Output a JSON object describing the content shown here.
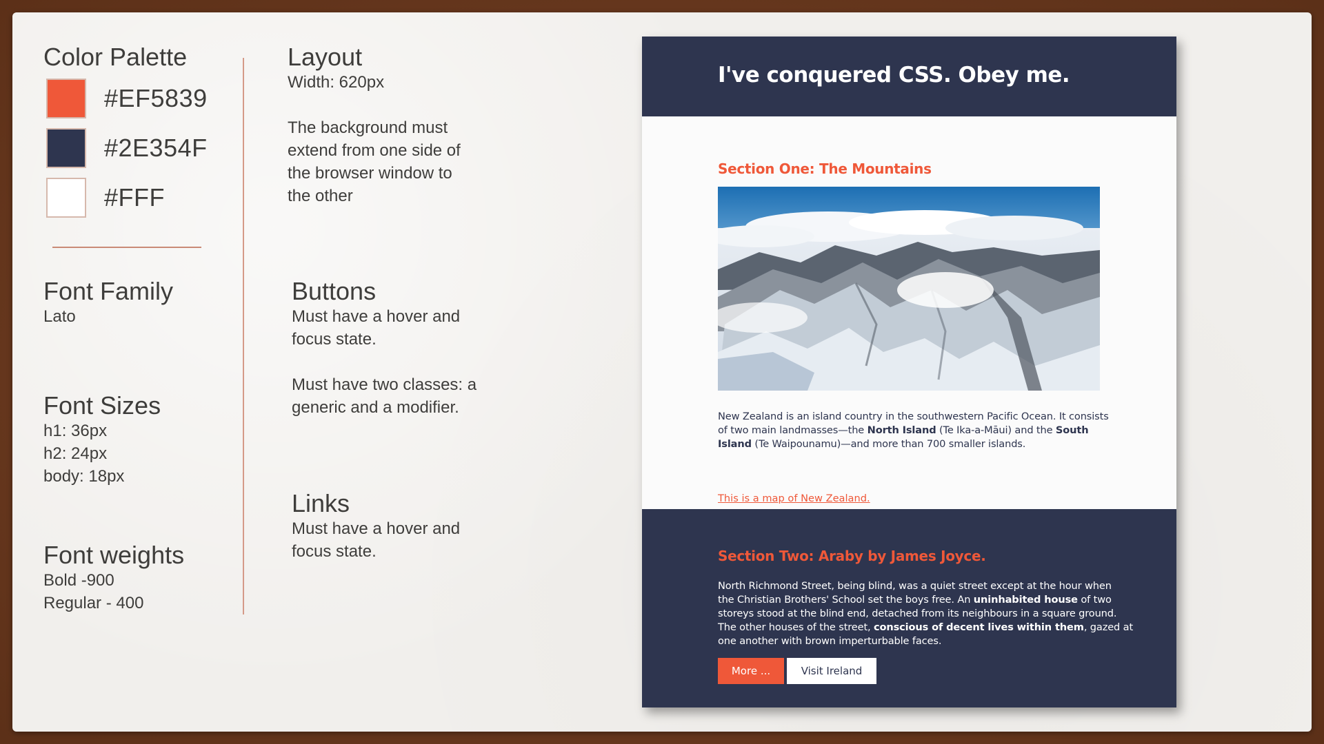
{
  "palette": {
    "title": "Color Palette",
    "colors": [
      {
        "hex": "#EF5839",
        "label": "#EF5839"
      },
      {
        "hex": "#2E354F",
        "label": "#2E354F"
      },
      {
        "hex": "#FFFFFF",
        "label": "#FFF"
      }
    ]
  },
  "font_family": {
    "title": "Font Family",
    "value": "Lato"
  },
  "font_sizes": {
    "title": "Font Sizes",
    "lines": [
      "h1: 36px",
      "h2: 24px",
      "body: 18px"
    ]
  },
  "font_weights": {
    "title": "Font weights",
    "lines": [
      "Bold -900",
      "Regular - 400"
    ]
  },
  "layout": {
    "title": "Layout",
    "width": "Width: 620px",
    "lines": [
      "The background must",
      "extend from one side of",
      "the browser window to",
      "the other"
    ]
  },
  "buttons": {
    "title": "Buttons",
    "lines1": [
      "Must have a hover and",
      "focus state."
    ],
    "lines2": [
      "Must have two classes: a",
      "generic and a modifier."
    ]
  },
  "links": {
    "title": "Links",
    "lines": [
      "Must have a hover and",
      "focus state."
    ]
  },
  "mock": {
    "h1": "I've conquered CSS. Obey me.",
    "section1": {
      "h2": "Section One: The Mountains",
      "image_alt": "snowy-mountain-photo",
      "p_line1": "New Zealand is an island country in the southwestern Pacific Ocean. It consists",
      "p_line2_a": "of two main landmasses—the ",
      "p_line2_b": "North Island",
      "p_line2_c": " (Te Ika-a-Māui) and the ",
      "p_line2_d": "South",
      "p_line3_a": "Island",
      "p_line3_b": " (Te Waipounamu)—and more than 700 smaller islands.",
      "link": "This is a map of New Zealand."
    },
    "section2": {
      "h2": "Section Two: Araby by James Joyce.",
      "l1": "North Richmond Street, being blind, was a quiet street except at the hour when",
      "l2a": "the Christian Brothers' School set the boys free. An ",
      "l2b": "uninhabited house",
      "l2c": " of two",
      "l3": "storeys stood at the blind end, detached from its neighbours in a square ground.",
      "l4a": "The other houses of the street, ",
      "l4b": "conscious of decent lives within them",
      "l4c": ", gazed at",
      "l5": "one another with brown imperturbable faces.",
      "btn_primary": "More ...",
      "btn_secondary": "Visit Ireland"
    }
  }
}
